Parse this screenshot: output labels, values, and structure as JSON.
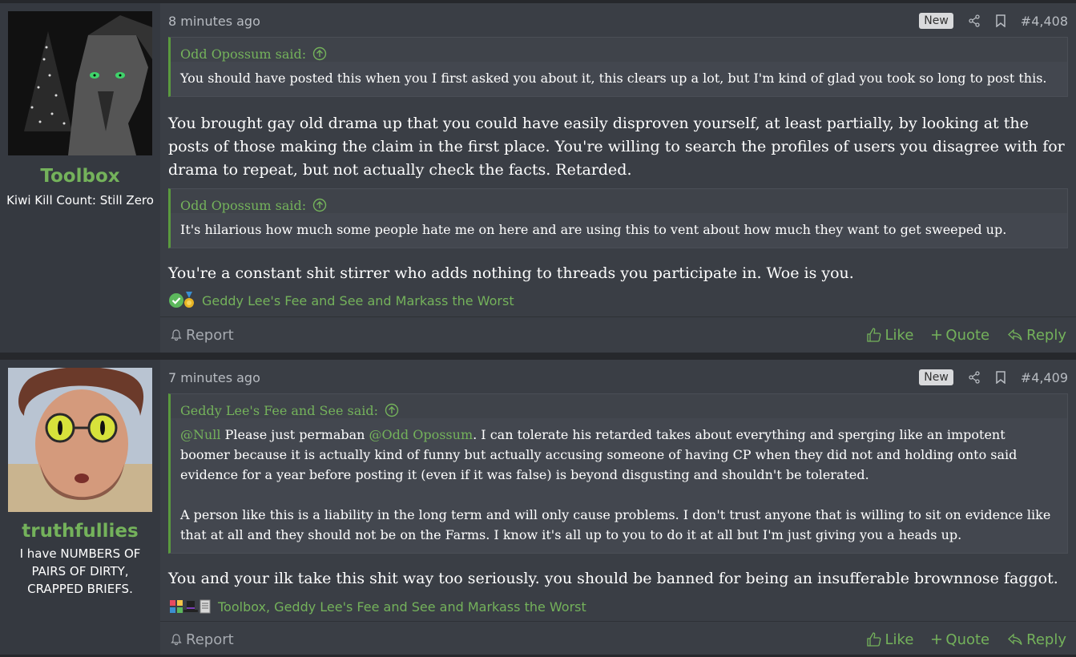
{
  "posts": [
    {
      "username": "Toolbox",
      "user_title": "Kiwi Kill Count: Still Zero",
      "time": "8 minutes ago",
      "new_badge": "New",
      "post_number": "#4,408",
      "quotes": [
        {
          "author": "Odd Opossum said:",
          "text": "You should have posted this when you I first asked you about it, this clears up a lot, but I'm kind of glad you took so long to post this."
        },
        {
          "author": "Odd Opossum said:",
          "text": "It's hilarious how much some people hate me on here and are using this to vent about how much they want to get sweeped up."
        }
      ],
      "paragraphs": [
        "You brought gay old drama up that you could have easily disproven yourself, at least partially, by looking at the posts of those making the claim in the first place. You're willing to search the profiles of users you disagree with for drama to repeat, but not actually check the facts. Retarded.",
        "You're a constant shit stirrer who adds nothing to threads you participate in. Woe is you."
      ],
      "reactions_text": "Geddy Lee's Fee and See and Markass the Worst",
      "footer": {
        "report": "Report",
        "like": "Like",
        "quote": "Quote",
        "reply": "Reply"
      }
    },
    {
      "username": "truthfullies",
      "user_title": "I have NUMBERS OF PAIRS OF DIRTY, CRAPPED BRIEFS.",
      "time": "7 minutes ago",
      "new_badge": "New",
      "post_number": "#4,409",
      "quotes": [
        {
          "author": "Geddy Lee's Fee and See said:",
          "mention1": "@Null",
          "text_a": " Please just permaban ",
          "mention2": "@Odd Opossum",
          "text_b": ". I can tolerate his retarded takes about everything and sperging like an impotent boomer because it is actually kind of funny but actually accusing someone of having CP when they did not and holding onto said evidence for a year before posting it (even if it was false) is beyond disgusting and shouldn't be tolerated.",
          "text_c": "A person like this is a liability in the long term and will only cause problems. I don't trust anyone that is willing to sit on evidence like that at all and they should not be on the Farms. I know it's all up to you to do it at all but I'm just giving you a heads up."
        }
      ],
      "paragraphs": [
        "You and your ilk take this shit way too seriously. you should be banned for being an insufferable brownnose faggot."
      ],
      "reactions_text": "Toolbox, Geddy Lee's Fee and See and Markass the Worst",
      "footer": {
        "report": "Report",
        "like": "Like",
        "quote": "Quote",
        "reply": "Reply"
      }
    }
  ],
  "colors": {
    "accent": "#74b25b",
    "post_bg": "#3a3e45",
    "user_cell_bg": "#353940",
    "page_bg": "#26282c"
  },
  "icons": [
    "share-icon",
    "bookmark-icon",
    "arrow-up-circle-icon",
    "bell-icon",
    "thumbs-up-icon",
    "plus-icon",
    "reply-icon",
    "checkmark-reaction-icon",
    "medal-reaction-icon",
    "puzzle-reaction-icon",
    "tophat-reaction-icon",
    "scroll-reaction-icon"
  ]
}
